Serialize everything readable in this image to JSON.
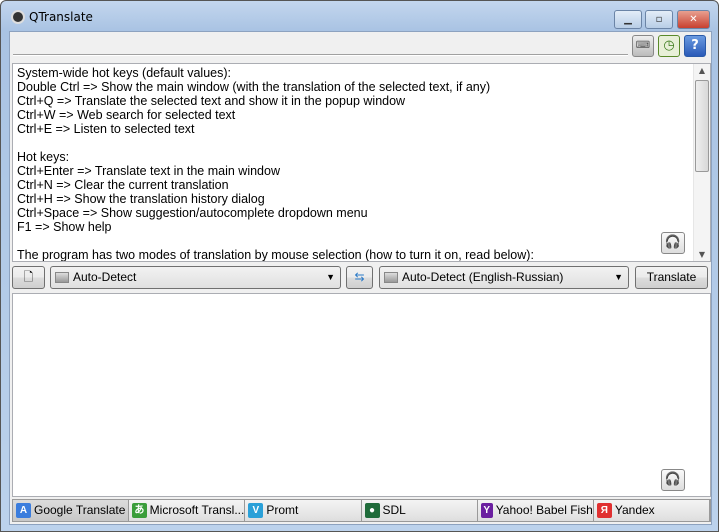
{
  "window": {
    "title": "QTranslate"
  },
  "toolbar": {
    "keyboard": "virtual-keyboard",
    "history": "history",
    "help": "?"
  },
  "source_text": {
    "lines": [
      "System-wide hot keys (default values):",
      "Double Ctrl => Show the main window (with the translation of the selected text, if any)",
      "Ctrl+Q => Translate the selected text and show it in the popup window",
      "Ctrl+W => Web search for selected text",
      "Ctrl+E => Listen to selected text",
      "",
      "Hot keys:",
      "Ctrl+Enter => Translate text in the main window",
      "Ctrl+N => Clear the current translation",
      "Ctrl+H => Show the translation history dialog",
      "Ctrl+Space => Show suggestion/autocomplete dropdown menu",
      "F1 => Show help",
      "",
      "The program has two modes of translation by mouse selection (how to turn it on, read below):"
    ]
  },
  "controls": {
    "source_lang": "Auto-Detect",
    "target_lang": "Auto-Detect (English-Russian)",
    "translate": "Translate"
  },
  "services": [
    {
      "label": "Google Translate",
      "color": "#3b7ddd",
      "glyph": "A"
    },
    {
      "label": "Microsoft Transl...",
      "color": "#3a9d3a",
      "glyph": "あ"
    },
    {
      "label": "Promt",
      "color": "#2aa0d8",
      "glyph": "V"
    },
    {
      "label": "SDL",
      "color": "#1f6b3a",
      "glyph": "●"
    },
    {
      "label": "Yahoo! Babel Fish",
      "color": "#6b1fa0",
      "glyph": "Y"
    },
    {
      "label": "Yandex",
      "color": "#e03030",
      "glyph": "Я"
    }
  ]
}
